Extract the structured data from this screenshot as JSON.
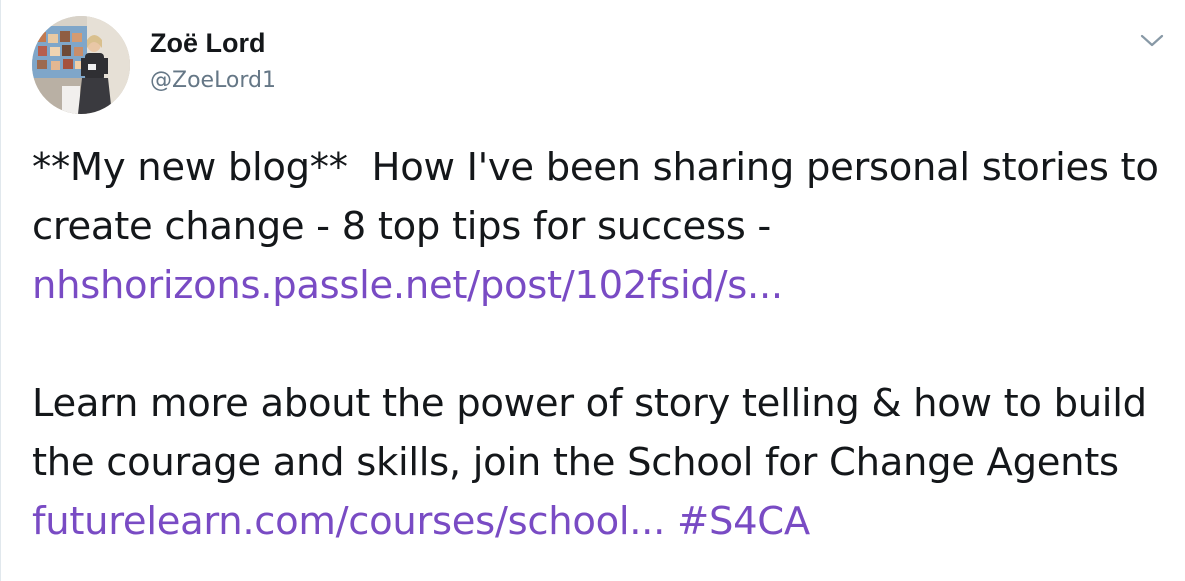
{
  "tweet": {
    "author": {
      "name": "Zoë Lord",
      "handle": "@ZoeLord1"
    },
    "menu_icon": "chevron-down-icon",
    "paragraph1": {
      "text_line": "**My new blog**  How I've been sharing personal stories to create change - 8 top tips for success - ",
      "link": "nhshorizons.passle.net/post/102fsid/s..."
    },
    "paragraph2": {
      "text_line": "Learn more about the power of story telling & how to build the courage and skills, join the School for Change Agents ",
      "link": "futurelearn.com/courses/school...",
      "spacer": " ",
      "hashtag": "#S4CA"
    },
    "colors": {
      "link": "#794bc4",
      "text": "#14171a",
      "handle": "#657786",
      "divider": "#e1e8ed"
    }
  }
}
